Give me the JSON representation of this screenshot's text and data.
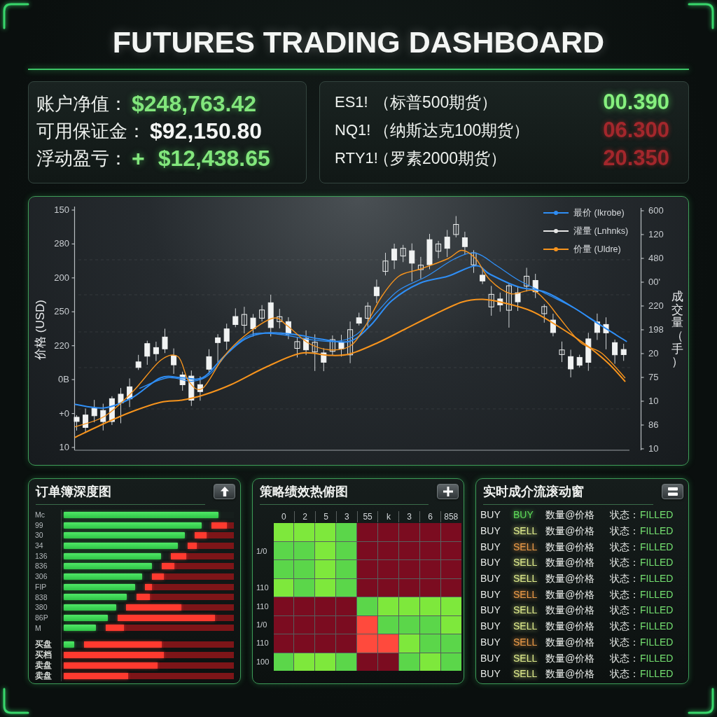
{
  "title": "FUTURES TRADING DASHBOARD",
  "account": {
    "rows": [
      {
        "label": "账户净值：",
        "value": "$248,763.42",
        "positive": true
      },
      {
        "label": "可用保证金：",
        "value": "$92,150.80",
        "positive": false
      },
      {
        "label": "浮动盈亏：",
        "sign": "+",
        "value": "$12,438.65",
        "positive": true
      }
    ]
  },
  "futures": [
    {
      "symbol": "ES1!",
      "name": "（标普500期货）",
      "price": "00.390",
      "up": true
    },
    {
      "symbol": "NQ1!",
      "name": "（纳斯达克100期货）",
      "price": "06.300",
      "up": false
    },
    {
      "symbol": "RTY1!",
      "name": "（罗素2000期货）",
      "price": "20.350",
      "up": false
    }
  ],
  "price_chart": {
    "y_axis_title": "价格 (USD)",
    "y_ticks": [
      "150",
      "280",
      "200",
      "250",
      "220",
      "0B",
      "+0",
      "10"
    ],
    "y2_axis_title": "成交量（手）",
    "y2_ticks": [
      "600",
      "120",
      "480",
      "00'",
      "220",
      "198",
      "20",
      "75",
      "10",
      "86",
      "10"
    ],
    "legend": [
      {
        "label": "最价 (Ikrobe)",
        "color": "#2f8ef5"
      },
      {
        "label": "灌量 (Lnhnks)",
        "color": "#e6e6e6"
      },
      {
        "label": "价量 (Uldre)",
        "color": "#f7941d"
      }
    ]
  },
  "order_book": {
    "title": "订单簿深度图",
    "price_rows": [
      {
        "label": "Mc",
        "bid": {
          "level": 0.91
        }
      },
      {
        "label": "99",
        "bid": {
          "level": 0.81
        },
        "ask": {
          "level": 0.68
        }
      },
      {
        "label": "30",
        "bid": {
          "level": 0.71
        },
        "ask": {
          "level": 0.31
        }
      },
      {
        "label": "34",
        "bid": {
          "level": 0.67
        },
        "ask": {
          "level": 0.2
        }
      },
      {
        "label": "136",
        "bid": {
          "level": 0.57
        },
        "ask": {
          "level": 0.25
        }
      },
      {
        "label": "836",
        "bid": {
          "level": 0.52
        },
        "ask": {
          "level": 0.17
        }
      },
      {
        "label": "306",
        "bid": {
          "level": 0.46
        },
        "ask": {
          "level": 0.15
        }
      },
      {
        "label": "FIP",
        "bid": {
          "level": 0.42
        },
        "ask": {
          "level": 0.08
        }
      },
      {
        "label": "838",
        "bid": {
          "level": 0.37
        },
        "ask": {
          "level": 0.14
        }
      },
      {
        "label": "380",
        "bid": {
          "level": 0.31
        },
        "ask": {
          "level": 0.51
        }
      },
      {
        "label": "86P",
        "bid": {
          "level": 0.26
        },
        "ask": {
          "level": 0.84
        }
      },
      {
        "label": "M",
        "bid": {
          "level": 0.19
        },
        "ask": {
          "level": 0.14
        }
      }
    ],
    "side_rows": [
      {
        "label": "买盘",
        "bid": {
          "level": 0.06
        },
        "ask": {
          "level": 0.52
        }
      },
      {
        "label": "买档",
        "ask": {
          "level": 0.59
        }
      },
      {
        "label": "卖盘",
        "ask": {
          "level": 0.55
        }
      },
      {
        "label": "卖盘",
        "ask": {
          "level": 0.38
        }
      }
    ]
  },
  "heatmap": {
    "title": "策略绩效热俯图",
    "columns": [
      "0",
      "2",
      "5",
      "3",
      "55",
      "k",
      "3",
      "6",
      "858"
    ],
    "rows": [
      {
        "cells": [
          {
            "color": "#7ee83c"
          },
          {
            "color": "#7ee83c"
          },
          {
            "color": "#7ee83c"
          },
          {
            "color": "#5bd64a"
          },
          {
            "color": "#7b0c20"
          },
          {
            "color": "#7b0c20"
          },
          {
            "color": "#7b0c20"
          },
          {
            "color": "#7b0c20"
          },
          {
            "color": "#7b0c20"
          }
        ]
      },
      {
        "label": "1/0",
        "cells": [
          {
            "color": "#5bd64a"
          },
          {
            "color": "#5bd64a"
          },
          {
            "color": "#7ee83c"
          },
          {
            "color": "#5bd64a"
          },
          {
            "color": "#7b0c20"
          },
          {
            "color": "#7b0c20"
          },
          {
            "color": "#7b0c20"
          },
          {
            "color": "#7b0c20"
          },
          {
            "color": "#7b0c20"
          }
        ]
      },
      {
        "cells": [
          {
            "color": "#5bd64a"
          },
          {
            "color": "#5bd64a"
          },
          {
            "color": "#7ee83c"
          },
          {
            "color": "#5bd64a"
          },
          {
            "color": "#7b0c20"
          },
          {
            "color": "#7b0c20"
          },
          {
            "color": "#7b0c20"
          },
          {
            "color": "#7b0c20"
          },
          {
            "color": "#7b0c20"
          }
        ]
      },
      {
        "label": "110",
        "cells": [
          {
            "color": "#7ee83c"
          },
          {
            "color": "#5bd64a"
          },
          {
            "color": "#7ee83c"
          },
          {
            "color": "#5bd64a"
          },
          {
            "color": "#7b0c20"
          },
          {
            "color": "#7b0c20"
          },
          {
            "color": "#7b0c20"
          },
          {
            "color": "#7b0c20"
          },
          {
            "color": "#7b0c20"
          }
        ]
      },
      {
        "label": "110",
        "cells": [
          {
            "color": "#7b0c20"
          },
          {
            "color": "#7b0c20"
          },
          {
            "color": "#7b0c20"
          },
          {
            "color": "#7b0c20"
          },
          {
            "color": "#5bd64a"
          },
          {
            "color": "#7ee83c"
          },
          {
            "color": "#7ee83c"
          },
          {
            "color": "#7ee83c"
          },
          {
            "color": "#7ee83c"
          }
        ]
      },
      {
        "label": "1/0",
        "cells": [
          {
            "color": "#7b0c20"
          },
          {
            "color": "#7b0c20"
          },
          {
            "color": "#7b0c20"
          },
          {
            "color": "#7b0c20"
          },
          {
            "color": "#ff4a3d"
          },
          {
            "color": "#5bd64a"
          },
          {
            "color": "#5bd64a"
          },
          {
            "color": "#5bd64a"
          },
          {
            "color": "#7ee83c"
          }
        ]
      },
      {
        "label": "110",
        "cells": [
          {
            "color": "#7b0c20"
          },
          {
            "color": "#7b0c20"
          },
          {
            "color": "#7b0c20"
          },
          {
            "color": "#7b0c20"
          },
          {
            "color": "#ff4a3d"
          },
          {
            "color": "#ff4a3d"
          },
          {
            "color": "#7ee83c"
          },
          {
            "color": "#5bd64a"
          },
          {
            "color": "#5bd64a"
          }
        ]
      },
      {
        "label": "100",
        "cells": [
          {
            "color": "#5bd64a"
          },
          {
            "color": "#7ee83c"
          },
          {
            "color": "#7ee83c"
          },
          {
            "color": "#5bd64a"
          },
          {
            "color": "#7b0c20"
          },
          {
            "color": "#7b0c20"
          },
          {
            "color": "#5bd64a"
          },
          {
            "color": "#7ee83c"
          },
          {
            "color": "#5bd64a"
          }
        ]
      }
    ]
  },
  "trades": {
    "title": "实时成介流滚动窗",
    "rows": [
      {
        "action": "BUY",
        "side": {
          "text": "BUY",
          "color": "#5fdc5a"
        },
        "detail": "数量@价格",
        "status_label": "状态：",
        "status": "FILLED"
      },
      {
        "action": "BUY",
        "side": {
          "text": "SELL",
          "color": "#e2ef8e"
        },
        "detail": "数量@价格",
        "status_label": "状态：",
        "status": "FILLED"
      },
      {
        "action": "BUY",
        "side": {
          "text": "SELL",
          "color": "#ee9c48"
        },
        "detail": "数量@价格",
        "status_label": "状态：",
        "status": "FILLED"
      },
      {
        "action": "BUY",
        "side": {
          "text": "SELL",
          "color": "#e2ef8e"
        },
        "detail": "数量@价格",
        "status_label": "状态：",
        "status": "FILLED"
      },
      {
        "action": "BUY",
        "side": {
          "text": "SELL",
          "color": "#e2ef8e"
        },
        "detail": "数量@价格",
        "status_label": "状态：",
        "status": "FILLED"
      },
      {
        "action": "BUY",
        "side": {
          "text": "SELL",
          "color": "#ee9c48"
        },
        "detail": "数量@价格",
        "status_label": "状态：",
        "status": "FILLED"
      },
      {
        "action": "BUY",
        "side": {
          "text": "SELL",
          "color": "#e2ef8e"
        },
        "detail": "数量@价格",
        "status_label": "状态：",
        "status": "FILLED"
      },
      {
        "action": "BUY",
        "side": {
          "text": "SELL",
          "color": "#e2ef8e"
        },
        "detail": "数量@价格",
        "status_label": "状态：",
        "status": "FILLED"
      },
      {
        "action": "BUY",
        "side": {
          "text": "SELL",
          "color": "#ee9c48"
        },
        "detail": "数量@价格",
        "status_label": "状态：",
        "status": "FILLED"
      },
      {
        "action": "BUY",
        "side": {
          "text": "SELL",
          "color": "#e2ef8e"
        },
        "detail": "数量@价格",
        "status_label": "状态：",
        "status": "FILLED"
      },
      {
        "action": "BUY",
        "side": {
          "text": "SELL",
          "color": "#e2ef8e"
        },
        "detail": "数量@价格",
        "status_label": "状态：",
        "status": "FILLED"
      }
    ]
  }
}
